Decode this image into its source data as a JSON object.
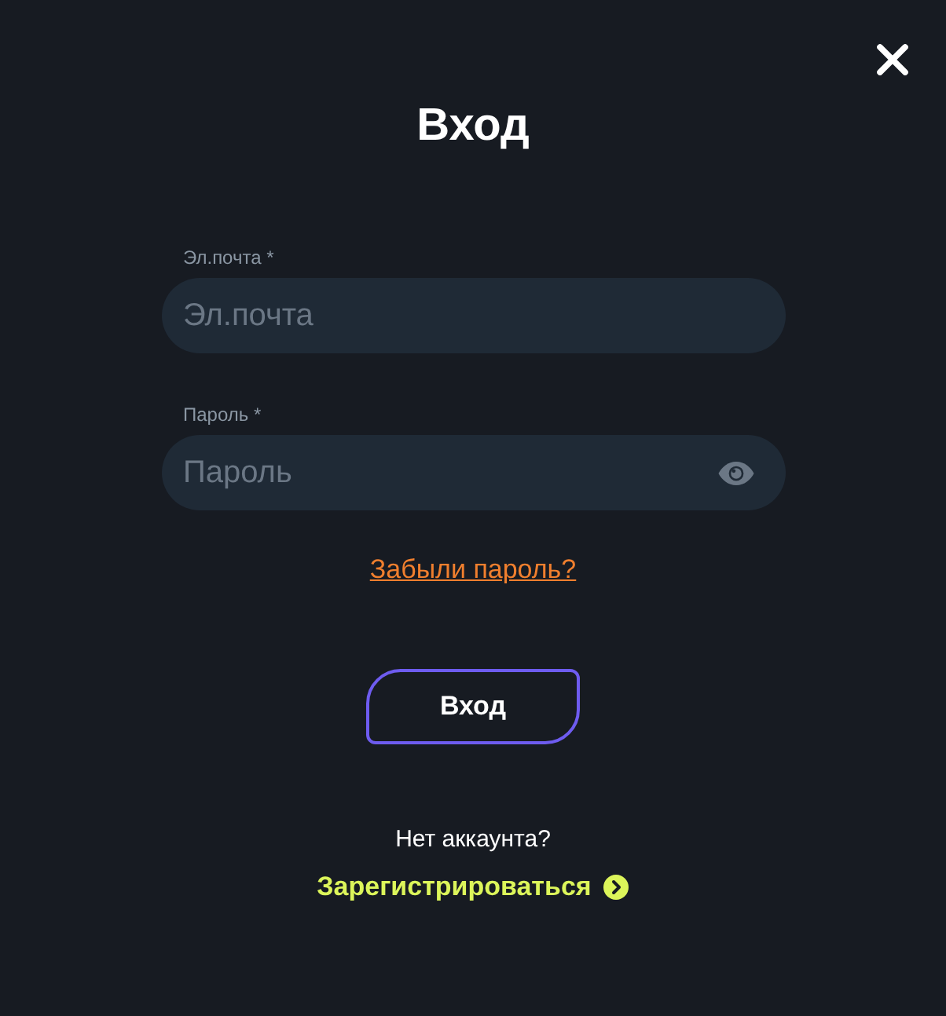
{
  "dialog": {
    "title": "Вход"
  },
  "fields": [
    {
      "kind": "email",
      "label": "Эл.почта *",
      "placeholder": "Эл.почта"
    },
    {
      "kind": "password",
      "label": "Пароль *",
      "placeholder": "Пароль"
    }
  ],
  "forgot_link": "Забыли пароль?",
  "submit_button": "Вход",
  "signup_prompt": "Нет аккаунта?",
  "signup_link": "Зарегистрироваться"
}
